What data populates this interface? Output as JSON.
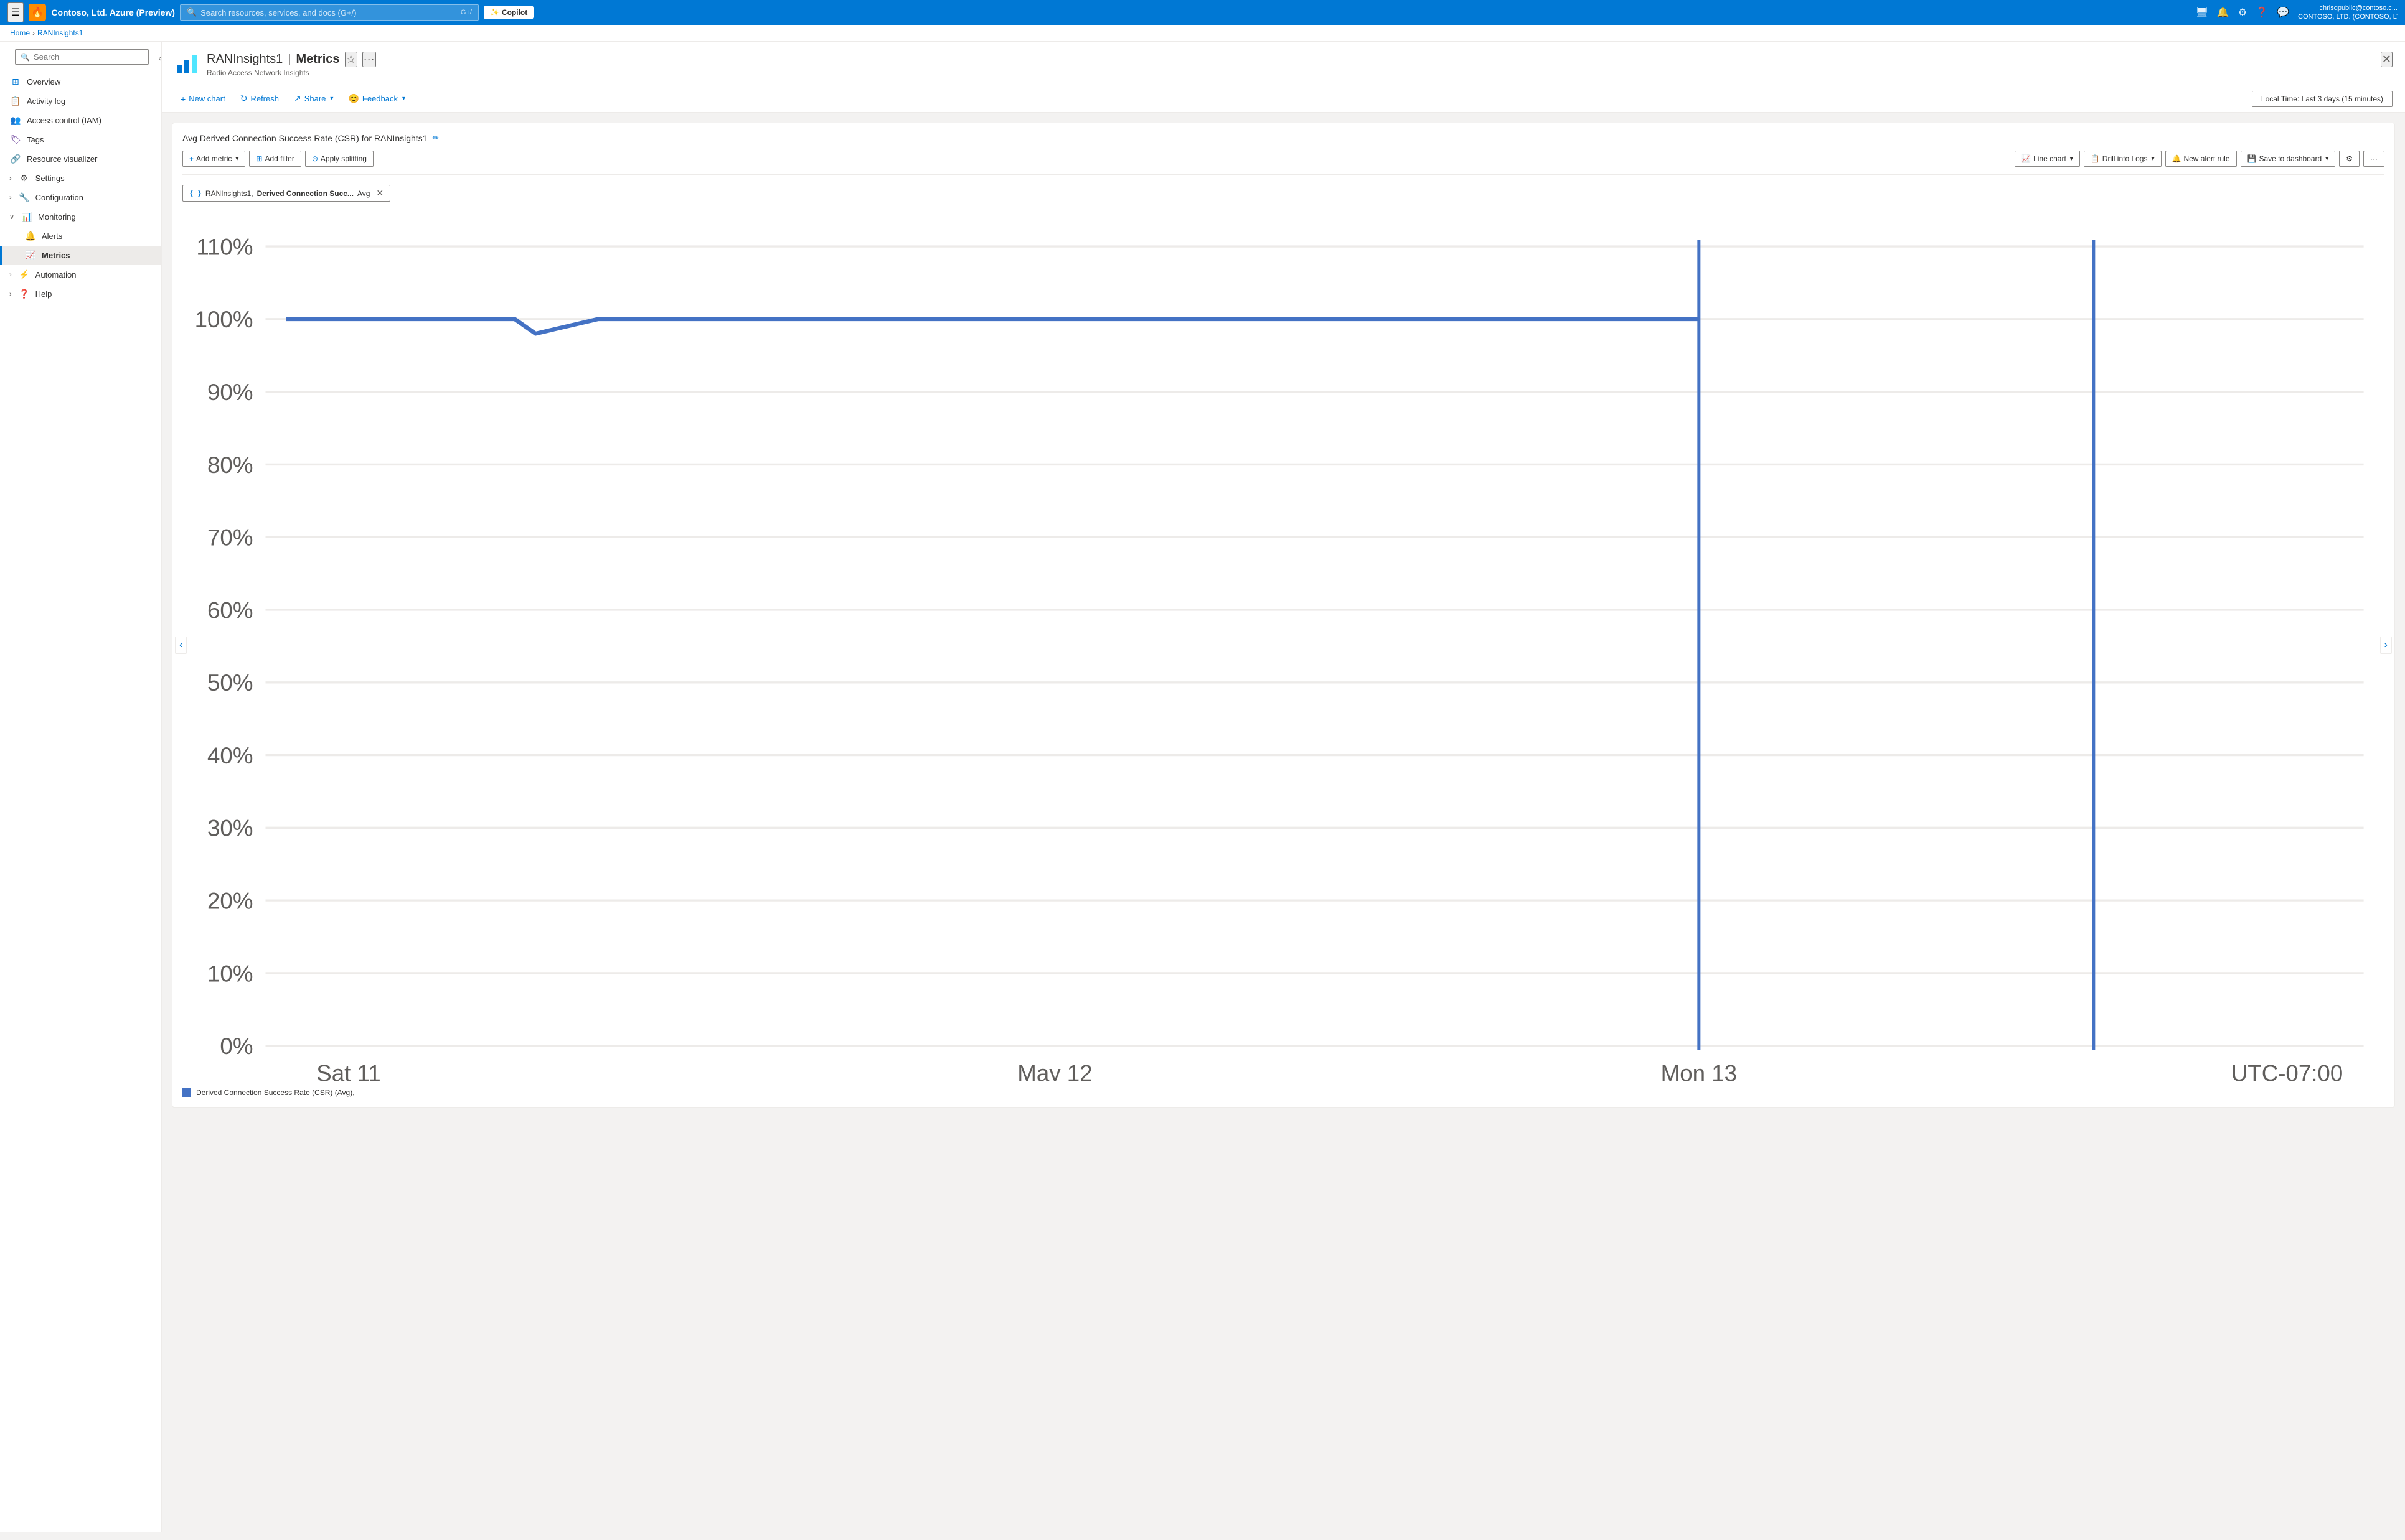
{
  "topnav": {
    "title": "Contoso, Ltd. Azure (Preview)",
    "search_placeholder": "Search resources, services, and docs (G+/)",
    "copilot_label": "Copilot",
    "user_name": "chrisqpublic@contoso.c...",
    "user_org": "CONTOSO, LTD. (CONTOSO, LTD...."
  },
  "breadcrumb": {
    "home": "Home",
    "resource": "RANInsights1"
  },
  "page_header": {
    "title_prefix": "RANInsights1",
    "title_suffix": "Metrics",
    "subtitle": "Radio Access Network Insights",
    "star_title": "Favorite",
    "more_title": "More"
  },
  "toolbar": {
    "new_chart": "New chart",
    "refresh": "Refresh",
    "share": "Share",
    "feedback": "Feedback",
    "time_range": "Local Time: Last 3 days (15 minutes)"
  },
  "sidebar": {
    "search_placeholder": "Search",
    "items": [
      {
        "id": "overview",
        "label": "Overview",
        "icon": "grid",
        "expandable": false
      },
      {
        "id": "activity-log",
        "label": "Activity log",
        "icon": "list",
        "expandable": false
      },
      {
        "id": "iam",
        "label": "Access control (IAM)",
        "icon": "people",
        "expandable": false
      },
      {
        "id": "tags",
        "label": "Tags",
        "icon": "tag",
        "expandable": false
      },
      {
        "id": "resource-visualizer",
        "label": "Resource visualizer",
        "icon": "hierarchy",
        "expandable": false
      },
      {
        "id": "settings",
        "label": "Settings",
        "icon": "settings",
        "expandable": true
      },
      {
        "id": "configuration",
        "label": "Configuration",
        "icon": "config",
        "expandable": true
      },
      {
        "id": "monitoring",
        "label": "Monitoring",
        "icon": "monitoring",
        "expandable": true,
        "expanded": true
      },
      {
        "id": "alerts",
        "label": "Alerts",
        "icon": "alerts",
        "indent": true
      },
      {
        "id": "metrics",
        "label": "Metrics",
        "icon": "metrics",
        "indent": true,
        "active": true
      },
      {
        "id": "automation",
        "label": "Automation",
        "icon": "automation",
        "expandable": true
      },
      {
        "id": "help",
        "label": "Help",
        "icon": "help",
        "expandable": true
      }
    ]
  },
  "chart": {
    "title": "Avg Derived Connection Success Rate (CSR) for RANInsights1",
    "add_metric": "Add metric",
    "add_filter": "Add filter",
    "apply_splitting": "Apply splitting",
    "line_chart": "Line chart",
    "drill_into_logs": "Drill into Logs",
    "new_alert_rule": "New alert rule",
    "save_to_dashboard": "Save to dashboard",
    "metric_tag_prefix": "RANInsights1,",
    "metric_tag_name": "Derived Connection Succ...",
    "metric_tag_agg": "Avg",
    "y_axis_labels": [
      "110%",
      "100%",
      "90%",
      "80%",
      "70%",
      "60%",
      "50%",
      "40%",
      "30%",
      "20%",
      "10%",
      "0%"
    ],
    "x_axis_labels": [
      "Sat 11",
      "May 12",
      "Mon 13",
      "UTC-07:00"
    ],
    "legend_label": "Derived Connection Success Rate (CSR) (Avg),",
    "data_value": 100
  }
}
